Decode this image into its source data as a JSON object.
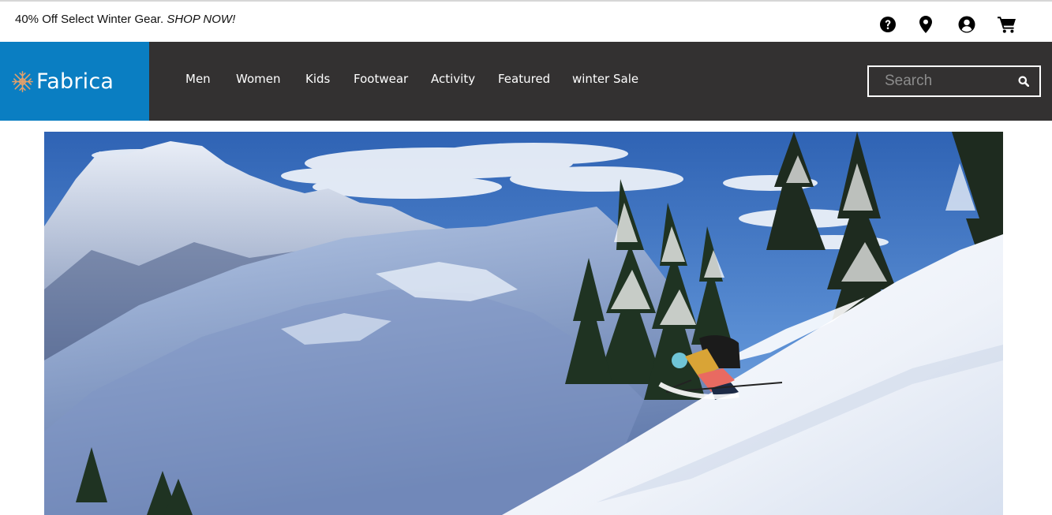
{
  "promo": {
    "text": "40% Off Select Winter Gear.",
    "cta": "SHOP NOW!"
  },
  "utility_icons": [
    {
      "name": "help",
      "icon": "question-circle-icon"
    },
    {
      "name": "store-locator",
      "icon": "map-pin-icon"
    },
    {
      "name": "account",
      "icon": "user-circle-icon"
    },
    {
      "name": "cart",
      "icon": "shopping-cart-icon"
    }
  ],
  "brand": {
    "name": "Fabrica",
    "logo_icon": "snowflake-icon",
    "color": "#0a7ec2"
  },
  "nav": {
    "items": [
      "Men",
      "Women",
      "Kids",
      "Footwear",
      "Activity",
      "Featured",
      "winter Sale"
    ]
  },
  "search": {
    "placeholder": "Search",
    "value": ""
  },
  "hero": {
    "scene": "skier descending snowy mountain slope with snow-covered pines"
  },
  "colors": {
    "header_bg": "#333131",
    "accent": "#0a7ec2"
  }
}
